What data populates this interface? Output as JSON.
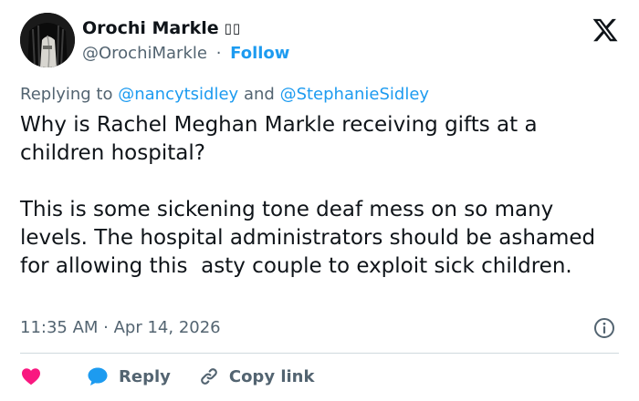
{
  "author": {
    "name": "Orochi Markle",
    "flag": "▯▯",
    "handle": "@OrochiMarkle",
    "separator": "·",
    "follow_label": "Follow"
  },
  "replying": {
    "prefix": "Replying to",
    "mention1": "@nancytsidley",
    "conj": "and",
    "mention2": "@StephanieSidley"
  },
  "tweet": {
    "paragraph1": "Why is Rachel Meghan Markle receiving gifts at a children hospital?",
    "paragraph2": "This is some sickening tone deaf mess on so many levels. The hospital administrators should be ashamed for allowing this  asty couple to exploit sick children."
  },
  "meta": {
    "timestamp": "11:35 AM · Apr 14, 2026"
  },
  "actions": {
    "reply_label": "Reply",
    "copy_link_label": "Copy link"
  },
  "icons": {
    "brand": "x-logo-icon",
    "info": "info-icon",
    "like": "heart-icon",
    "reply": "speech-bubble-icon",
    "copy": "link-icon"
  },
  "colors": {
    "text": "#0f1419",
    "muted": "#536471",
    "accent": "#1d9bf0",
    "like": "#f91880",
    "divider": "#cfd9de"
  }
}
